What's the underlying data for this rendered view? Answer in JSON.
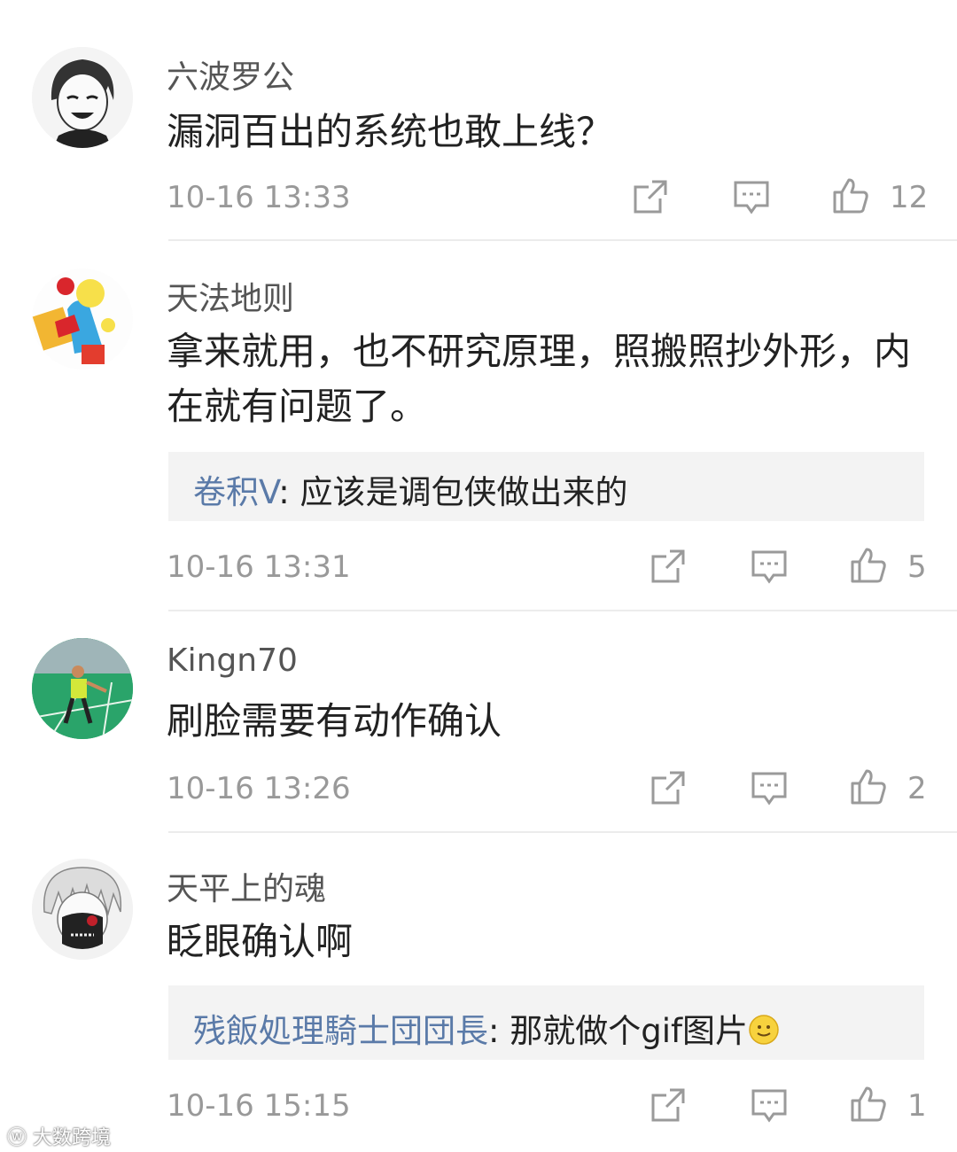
{
  "comments": [
    {
      "username": "六波罗公",
      "text": "漏洞百出的系统也敢上线？",
      "time": "10-16 13:33",
      "likes": "12",
      "avatar_icon": "manga-boy-avatar"
    },
    {
      "username": "天法地则",
      "text": "拿来就用，也不研究原理，照搬照抄外形，内在就有问题了。",
      "reply": {
        "name": "卷积V",
        "text": ": 应该是调包侠做出来的"
      },
      "time": "10-16 13:31",
      "likes": "5",
      "avatar_icon": "cartoon-character-avatar"
    },
    {
      "username": "Kingn70",
      "text": "刷脸需要有动作确认",
      "time": "10-16 13:26",
      "likes": "2",
      "avatar_icon": "badminton-player-avatar"
    },
    {
      "username": "天平上的魂",
      "text": "眨眼确认啊",
      "reply": {
        "name": "残飯処理騎士団団長",
        "text": ": 那就做个gif图片"
      },
      "time": "10-16 15:15",
      "likes": "1",
      "avatar_icon": "masked-anime-avatar"
    }
  ],
  "watermark": "大数跨境",
  "colors": {
    "reply_name": "#5a7aa8",
    "meta": "#999999",
    "divider": "#ececec"
  },
  "icons": {
    "share": "share-icon",
    "comment": "comment-icon",
    "like": "thumbs-up-icon",
    "emoji": "smiley-emoji"
  }
}
